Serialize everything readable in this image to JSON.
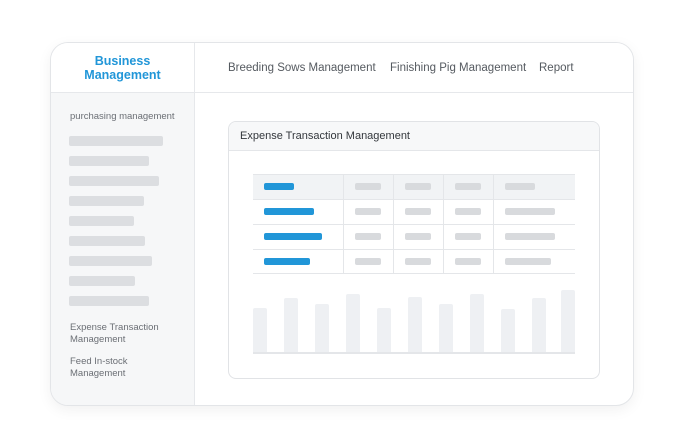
{
  "brand": {
    "line1": "Business",
    "line2": "Management"
  },
  "topnav": {
    "items": [
      "Breeding Sows Management",
      "Finishing Pig Management",
      "Report"
    ]
  },
  "sidebar": {
    "section_title": "purchasing management",
    "items": [
      {
        "line1": "Expense Transaction",
        "line2": "Management"
      },
      {
        "line1": "Feed In-stock",
        "line2": "Management"
      }
    ]
  },
  "card": {
    "title": "Expense Transaction Management"
  },
  "colors": {
    "accent": "#2196d8",
    "skeleton": "#dcdee1",
    "border": "#e4e6e9"
  }
}
